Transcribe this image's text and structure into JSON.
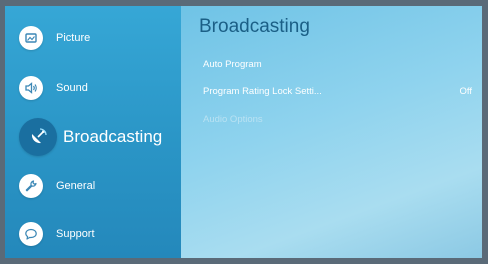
{
  "sidebar": {
    "items": [
      {
        "label": "Picture",
        "icon": "picture-icon"
      },
      {
        "label": "Sound",
        "icon": "speaker-icon"
      },
      {
        "label": "Broadcasting",
        "icon": "satellite-dish-icon",
        "selected": true
      },
      {
        "label": "General",
        "icon": "wrench-icon"
      },
      {
        "label": "Support",
        "icon": "chat-bubble-icon"
      }
    ]
  },
  "panel": {
    "title": "Broadcasting",
    "items": [
      {
        "label": "Auto Program",
        "value": ""
      },
      {
        "label": "Program Rating Lock Setti...",
        "value": "Off"
      },
      {
        "label": "Audio Options",
        "value": "",
        "disabled": true
      }
    ]
  },
  "colors": {
    "sidebar_bg": "#2b92c4",
    "panel_bg": "#8fd3ee",
    "title_color": "#1b5f86",
    "selected_icon_bg": "#1a6fa0"
  }
}
